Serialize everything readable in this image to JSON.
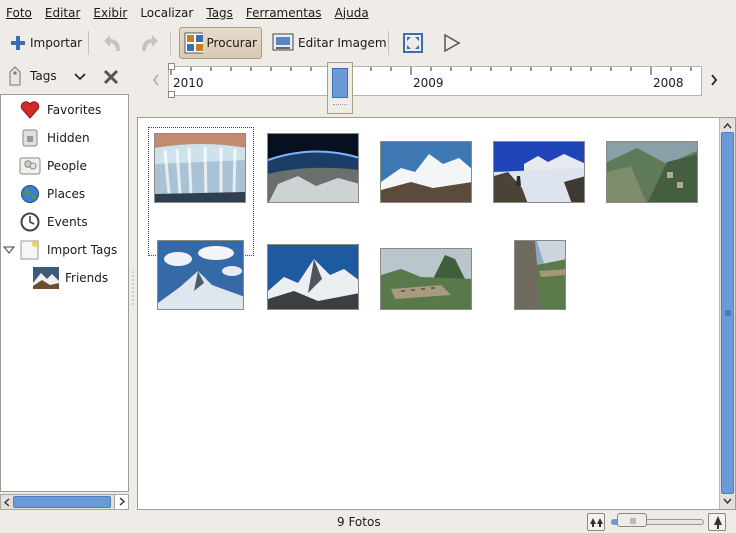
{
  "menu": [
    {
      "label": "Foto",
      "key": "F"
    },
    {
      "label": "Editar",
      "key": "E"
    },
    {
      "label": "Exibir",
      "key": "E"
    },
    {
      "label": "Localizar",
      "key": ""
    },
    {
      "label": "Tags",
      "key": "T"
    },
    {
      "label": "Ferramentas",
      "key": "F"
    },
    {
      "label": "Ajuda",
      "key": "A"
    }
  ],
  "toolbar": {
    "import_label": "Importar",
    "browse_label": "Procurar",
    "edit_label": "Editar Imagem"
  },
  "sidebar": {
    "header_label": "Tags",
    "items": [
      {
        "label": "Favorites",
        "icon": "heart-icon"
      },
      {
        "label": "Hidden",
        "icon": "lock-icon"
      },
      {
        "label": "People",
        "icon": "people-icon"
      },
      {
        "label": "Places",
        "icon": "globe-icon"
      },
      {
        "label": "Events",
        "icon": "clock-icon"
      },
      {
        "label": "Import Tags",
        "icon": "import-tag-icon"
      },
      {
        "label": "Friends",
        "icon": "friends-photo-icon"
      }
    ]
  },
  "timeline": {
    "years": [
      "2010",
      "2009",
      "2008"
    ]
  },
  "photos": [
    {
      "subject": "waterfall"
    },
    {
      "subject": "earth-orbit"
    },
    {
      "subject": "snow-mountain"
    },
    {
      "subject": "hiker-clouds"
    },
    {
      "subject": "valley-ruins"
    },
    {
      "subject": "sky-peak"
    },
    {
      "subject": "everest"
    },
    {
      "subject": "machu-picchu"
    },
    {
      "subject": "cliff-path"
    }
  ],
  "status": {
    "count_text": "9 Fotos"
  },
  "colors": {
    "selection_blue": "#6a9bd6",
    "active_button": "#d7cab3",
    "heart_red": "#d42a2a"
  }
}
